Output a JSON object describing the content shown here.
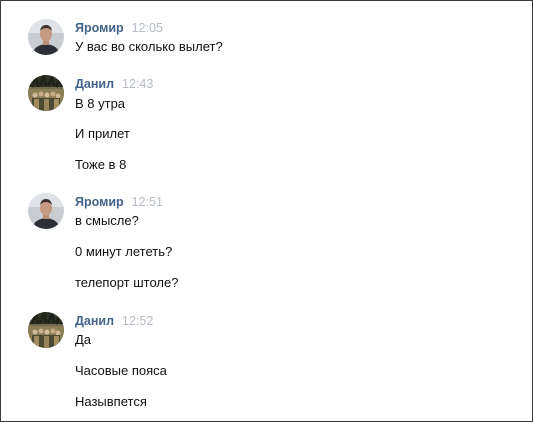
{
  "messages": [
    {
      "author": "Яромир",
      "time": "12:05",
      "avatar_icon": "user-photo-man",
      "lines": [
        "У вас во сколько вылет?"
      ]
    },
    {
      "author": "Данил",
      "time": "12:43",
      "avatar_icon": "user-photo-group",
      "lines": [
        "В 8 утра",
        "И прилет",
        "Тоже в 8"
      ]
    },
    {
      "author": "Яромир",
      "time": "12:51",
      "avatar_icon": "user-photo-man",
      "lines": [
        "в смысле?",
        "0 минут лететь?",
        "телепорт штоле?"
      ]
    },
    {
      "author": "Данил",
      "time": "12:52",
      "avatar_icon": "user-photo-group",
      "lines": [
        "Да",
        "Часовые пояса",
        "Назывпется"
      ]
    }
  ],
  "colors": {
    "author": "#42648b",
    "time": "#b5bbc3",
    "text": "#111111",
    "border": "#3a3a3a"
  }
}
